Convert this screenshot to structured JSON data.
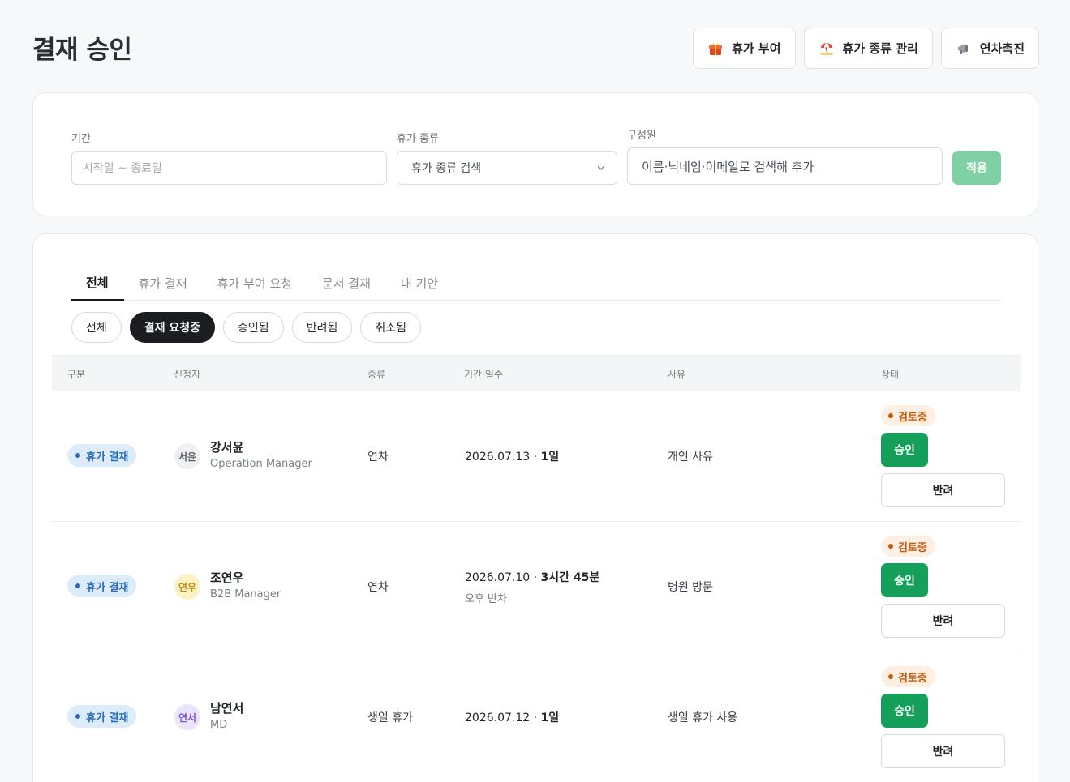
{
  "page": {
    "title": "결재 승인"
  },
  "top_actions": [
    {
      "label": "휴가 부여",
      "icon": "gift-icon"
    },
    {
      "label": "휴가 종류 관리",
      "icon": "beach-umbrella-icon"
    },
    {
      "label": "연차촉진",
      "icon": "megaphone-icon"
    }
  ],
  "filters": {
    "period": {
      "label": "기간",
      "placeholder": "시작일 ~ 종료일",
      "value": ""
    },
    "leave_type": {
      "label": "휴가 종류",
      "value": "휴가 종류 검색"
    },
    "member": {
      "label": "구성원",
      "value": "이름·닉네임·이메일로 검색해 추가"
    },
    "apply_label": "적용"
  },
  "tabs": [
    {
      "label": "전체",
      "active": true
    },
    {
      "label": "휴가 결재",
      "active": false
    },
    {
      "label": "휴가 부여 요청",
      "active": false
    },
    {
      "label": "문서 결재",
      "active": false
    },
    {
      "label": "내 기안",
      "active": false
    }
  ],
  "status_chips": [
    {
      "label": "전체",
      "active": false
    },
    {
      "label": "결재 요청중",
      "active": true
    },
    {
      "label": "승인됨",
      "active": false
    },
    {
      "label": "반려됨",
      "active": false
    },
    {
      "label": "취소됨",
      "active": false
    }
  ],
  "table": {
    "headers": [
      "구분",
      "신청자",
      "종류",
      "기간·일수",
      "사유",
      "상태"
    ],
    "rows": [
      {
        "category": "휴가 결재",
        "avatar": "서윤",
        "avatar_bg": "#f0f1f3",
        "avatar_fg": "#5a5f66",
        "name": "강서윤",
        "role": "Operation Manager",
        "kind": "연차",
        "period_date": "2026.07.13",
        "period_sep": " · ",
        "period_days": "1일",
        "period_sub": "",
        "reason": "개인 사유",
        "status": "검토중",
        "approve_label": "승인",
        "reject_label": "반려"
      },
      {
        "category": "휴가 결재",
        "avatar": "연우",
        "avatar_bg": "#fdf2c4",
        "avatar_fg": "#c08a12",
        "name": "조연우",
        "role": "B2B Manager",
        "kind": "연차",
        "period_date": "2026.07.10",
        "period_sep": " · ",
        "period_days": "3시간 45분",
        "period_sub": "오후 반차",
        "reason": "병원 방문",
        "status": "검토중",
        "approve_label": "승인",
        "reject_label": "반려"
      },
      {
        "category": "휴가 결재",
        "avatar": "연서",
        "avatar_bg": "#ebe4fb",
        "avatar_fg": "#7b55d6",
        "name": "남연서",
        "role": "MD",
        "kind": "생일 휴가",
        "period_date": "2026.07.12",
        "period_sep": " · ",
        "period_days": "1일",
        "period_sub": "",
        "reason": "생일 휴가 사용",
        "status": "검토중",
        "approve_label": "승인",
        "reject_label": "반려"
      }
    ]
  },
  "colors": {
    "primary_green": "#14a05a",
    "apply_disabled": "#7fd0a4",
    "badge_blue": "#2869b5",
    "status_orange": "#c7590a"
  }
}
